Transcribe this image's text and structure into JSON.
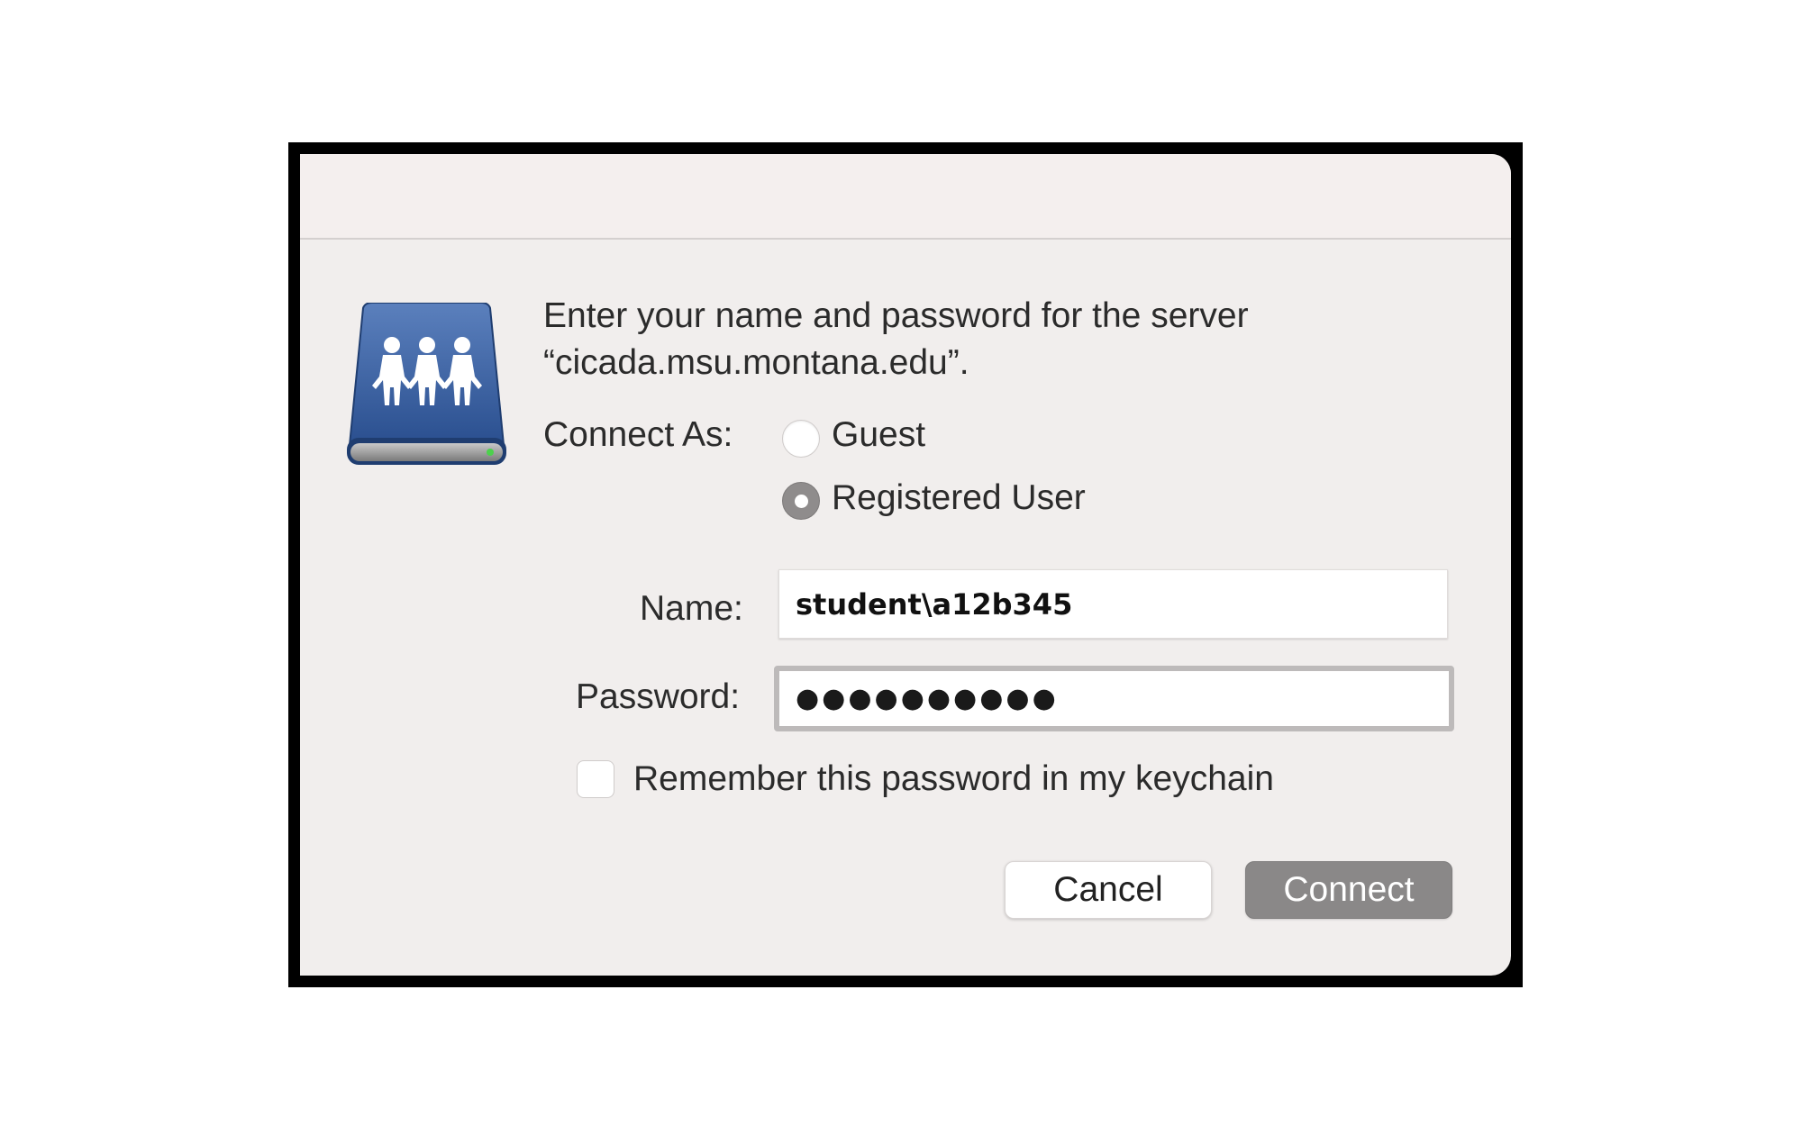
{
  "dialog": {
    "prompt_line1": "Enter your name and password for the server",
    "prompt_line2": "“cicada.msu.montana.edu”.",
    "connect_as_label": "Connect As:",
    "options": {
      "guest": "Guest",
      "registered_user": "Registered User",
      "selected": "Registered User"
    },
    "name_label": "Name:",
    "name_value": "student\\a12b345",
    "password_label": "Password:",
    "password_mask": "●●●●●●●●●●",
    "remember_label": "Remember this password in my keychain",
    "remember_checked": false,
    "cancel_label": "Cancel",
    "connect_label": "Connect",
    "icon": "shared-server-drive-icon"
  }
}
